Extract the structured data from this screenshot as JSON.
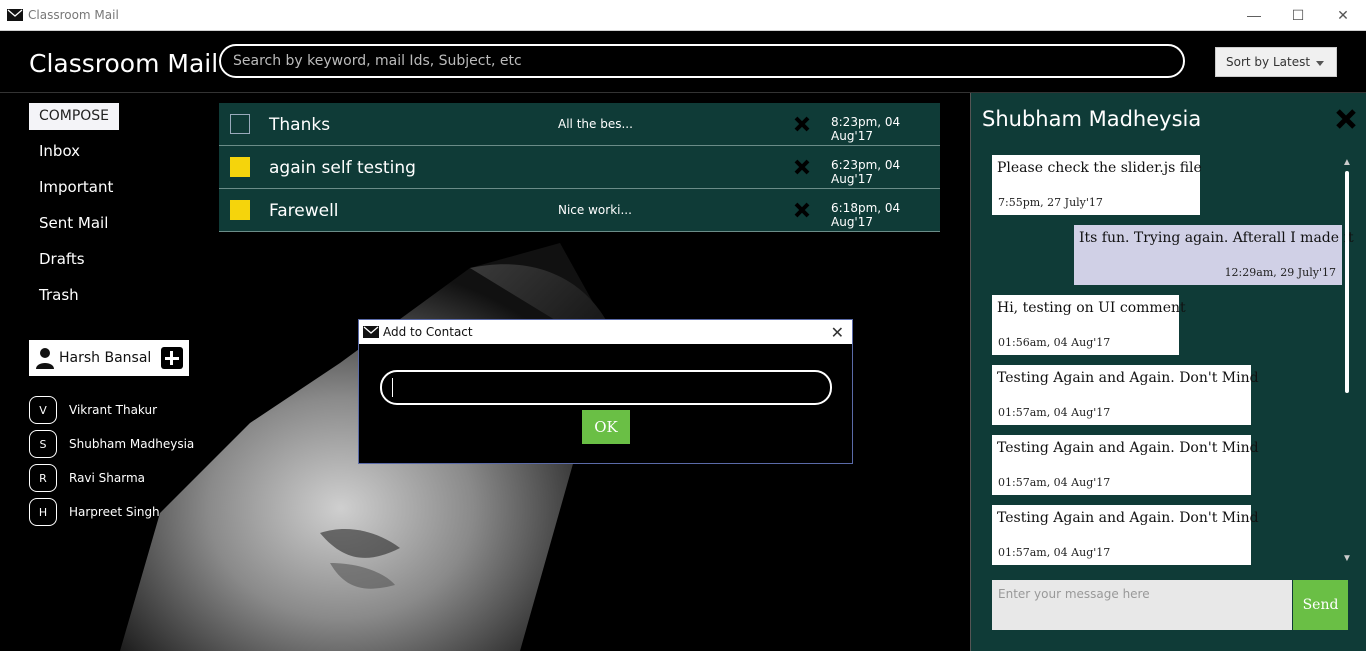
{
  "window": {
    "title": "Classroom Mail"
  },
  "header": {
    "brand": "Classroom Mail",
    "search_placeholder": "Search by keyword, mail Ids, Subject, etc",
    "sort_label": "Sort by Latest"
  },
  "sidebar": {
    "compose": "COMPOSE",
    "items": [
      {
        "label": "Inbox"
      },
      {
        "label": "Important"
      },
      {
        "label": "Sent Mail"
      },
      {
        "label": "Drafts"
      },
      {
        "label": "Trash"
      }
    ],
    "user": {
      "name": "Harsh Bansal"
    },
    "contacts": [
      {
        "initial": "V",
        "name": "Vikrant Thakur"
      },
      {
        "initial": "S",
        "name": "Shubham Madheysia"
      },
      {
        "initial": "R",
        "name": "Ravi Sharma"
      },
      {
        "initial": "H",
        "name": "Harpreet Singh"
      }
    ]
  },
  "mails": [
    {
      "subject": "Thanks",
      "preview": "All the bes...",
      "time": "8:23pm, 04 Aug'17",
      "checked": false
    },
    {
      "subject": "again self testing",
      "preview": "",
      "time": "6:23pm, 04 Aug'17",
      "checked": true
    },
    {
      "subject": "Farewell",
      "preview": "Nice worki...",
      "time": "6:18pm, 04 Aug'17",
      "checked": true
    }
  ],
  "dialog": {
    "title": "Add to Contact",
    "input_value": "",
    "ok_label": "OK"
  },
  "chat": {
    "contact_name": "Shubham Madheysia",
    "messages": [
      {
        "text": "Please check the slider.js file",
        "time": "7:55pm, 27 July'17",
        "mine": false
      },
      {
        "text": "Its fun. Trying again. Afterall I made it",
        "time": "12:29am, 29 July'17",
        "mine": true
      },
      {
        "text": "Hi, testing on UI comment",
        "time": "01:56am, 04 Aug'17",
        "mine": false
      },
      {
        "text": "Testing Again and Again. Don't Mind",
        "time": "01:57am, 04 Aug'17",
        "mine": false
      },
      {
        "text": "Testing Again and Again. Don't Mind",
        "time": "01:57am, 04 Aug'17",
        "mine": false
      },
      {
        "text": "Testing Again and Again. Don't Mind",
        "time": "01:57am, 04 Aug'17",
        "mine": false
      }
    ],
    "input_placeholder": "Enter your message here",
    "send_label": "Send"
  },
  "colors": {
    "panel": "#0f3b37",
    "accent_green": "#6abf45",
    "check_yellow": "#f5d40c"
  }
}
